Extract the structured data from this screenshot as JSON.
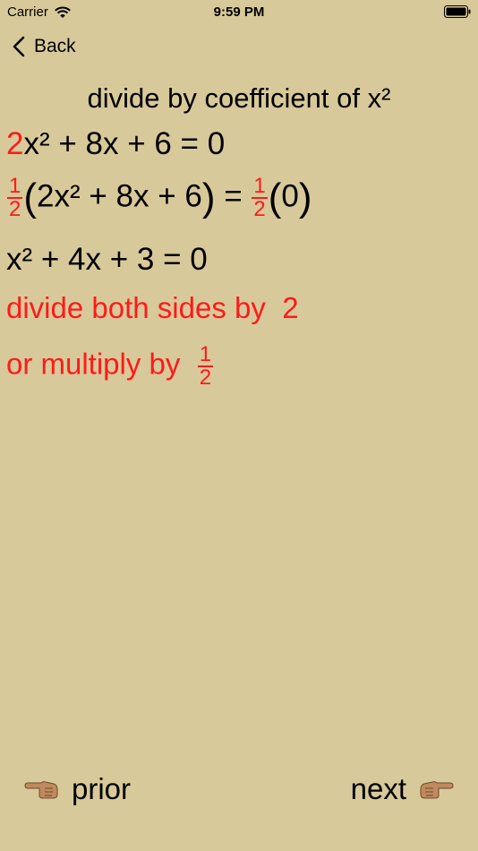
{
  "status": {
    "carrier": "Carrier",
    "time": "9:59 PM"
  },
  "nav": {
    "back_label": "Back"
  },
  "title": "divide by coefficient of x²",
  "eq1": {
    "coef": "2",
    "rest": "x² + 8x + 6 = 0"
  },
  "eq2": {
    "frac_num": "1",
    "frac_den": "2",
    "lparen": "(",
    "inner": "2x² + 8x + 6",
    "rparen": ")",
    "equals": " = ",
    "frac2_num": "1",
    "frac2_den": "2",
    "lparen2": "(",
    "inner2": "0",
    "rparen2": ")"
  },
  "eq3": "x² + 4x + 3 = 0",
  "note1": {
    "text": "divide both sides by",
    "value": "2"
  },
  "note2": {
    "text": "or multiply by",
    "frac_num": "1",
    "frac_den": "2"
  },
  "footer": {
    "prior_label": "prior",
    "next_label": "next"
  },
  "colors": {
    "background": "#d8c99a",
    "accent": "#ff1a1a"
  }
}
